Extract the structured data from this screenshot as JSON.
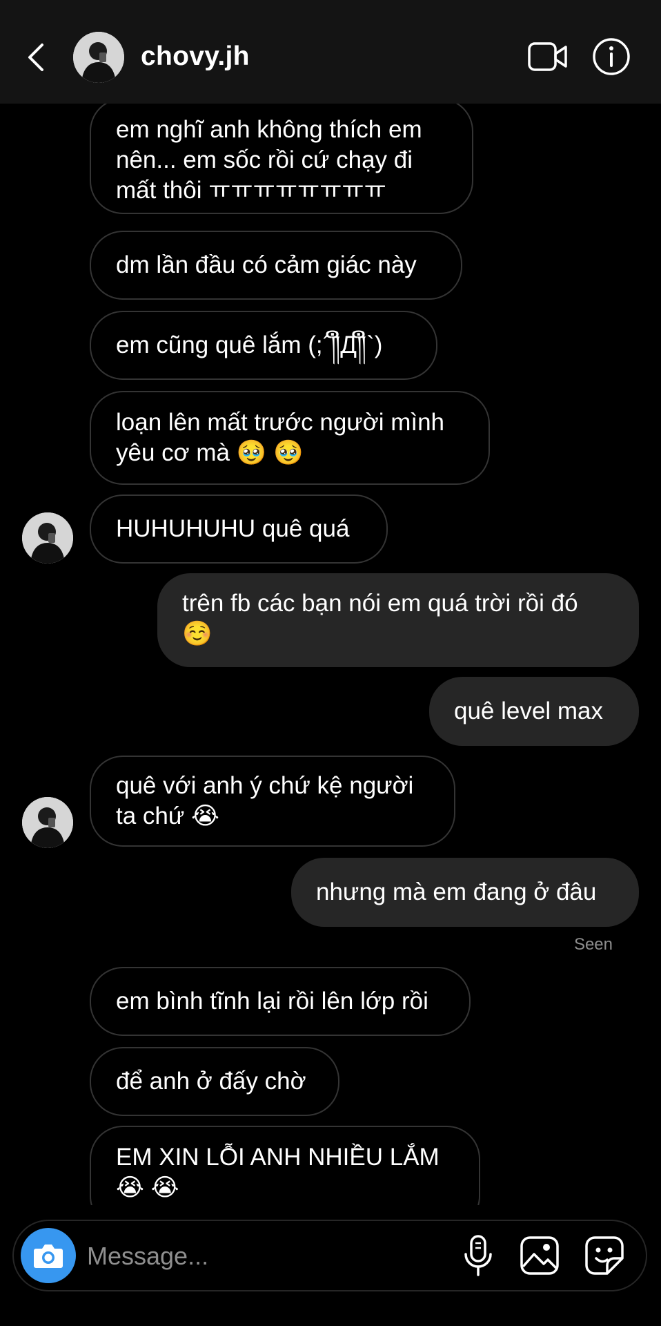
{
  "header": {
    "username": "chovy.jh",
    "back_icon": "chevron-left-icon",
    "video_icon": "video-call-icon",
    "info_icon": "info-icon"
  },
  "messages": [
    {
      "id": "m1",
      "side": "in",
      "text": "em nghĩ anh không thích em\nnên... em sốc rồi cứ chạy đi\nmất thôi ㅠㅠㅠㅠㅠㅠㅠㅠ"
    },
    {
      "id": "m2",
      "side": "in",
      "text": "dm lần đầu có cảm giác này"
    },
    {
      "id": "m3",
      "side": "in",
      "text": "em cũng quê lắm (;´༎ຶД༎ຶ`)"
    },
    {
      "id": "m4",
      "side": "in",
      "text": "loạn lên mất trước người mình\nyêu cơ mà 🥹 🥹"
    },
    {
      "id": "m5",
      "side": "in",
      "text": "HUHUHUHU quê quá"
    },
    {
      "id": "m6",
      "side": "out",
      "text": "trên fb các bạn nói em quá trời rồi đó\n☺️"
    },
    {
      "id": "m7",
      "side": "out",
      "text": "quê level max"
    },
    {
      "id": "m8",
      "side": "in",
      "text": "quê với anh ý chứ kệ người\nta chứ 😭"
    },
    {
      "id": "m9",
      "side": "out",
      "text": "nhưng mà em đang ở đâu"
    },
    {
      "id": "m10",
      "side": "in",
      "text": "em bình tĩnh lại rồi lên lớp rồi"
    },
    {
      "id": "m11",
      "side": "in",
      "text": "để anh ở đấy chờ"
    },
    {
      "id": "m12",
      "side": "in",
      "text": "EM XIN LỖI ANH NHIỀU LẮM\n😭 😭"
    }
  ],
  "seen_label": "Seen",
  "composer": {
    "placeholder": "Message...",
    "camera_icon": "camera-icon",
    "mic_icon": "microphone-icon",
    "gallery_icon": "gallery-icon",
    "sticker_icon": "sticker-icon"
  },
  "colors": {
    "background": "#000000",
    "header_bg": "#141414",
    "outgoing_bubble": "#262626",
    "incoming_border": "#343434",
    "accent": "#3797f0",
    "muted_text": "#8e8e8e"
  }
}
